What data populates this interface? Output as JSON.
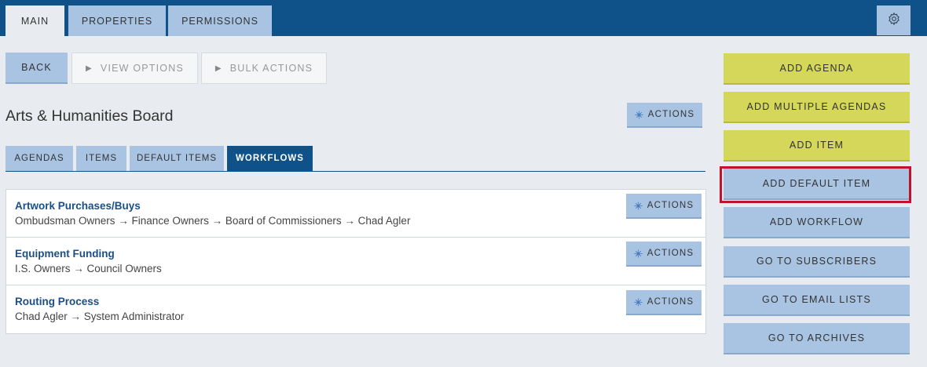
{
  "top_tabs": [
    {
      "label": "MAIN"
    },
    {
      "label": "PROPERTIES"
    },
    {
      "label": "PERMISSIONS"
    }
  ],
  "settings_icon": "gear-icon",
  "toolbar": {
    "back_label": "BACK",
    "view_options_label": "VIEW OPTIONS",
    "bulk_actions_label": "BULK ACTIONS"
  },
  "board": {
    "title": "Arts & Humanities Board",
    "actions_label": "ACTIONS"
  },
  "sub_tabs": [
    {
      "label": "AGENDAS"
    },
    {
      "label": "ITEMS"
    },
    {
      "label": "DEFAULT ITEMS"
    },
    {
      "label": "WORKFLOWS"
    }
  ],
  "workflows": [
    {
      "title": "Artwork Purchases/Buys",
      "steps": "Ombudsman Owners → Finance Owners → Board of Commissioners → Chad Agler",
      "actions_label": "ACTIONS"
    },
    {
      "title": "Equipment Funding",
      "steps": "I.S. Owners → Council Owners",
      "actions_label": "ACTIONS"
    },
    {
      "title": "Routing Process",
      "steps": "Chad Agler → System Administrator",
      "actions_label": "ACTIONS"
    }
  ],
  "sidebar": {
    "add_agenda": "ADD AGENDA",
    "add_multiple_agendas": "ADD MULTIPLE AGENDAS",
    "add_item": "ADD ITEM",
    "add_default_item": "ADD DEFAULT ITEM",
    "add_workflow": "ADD WORKFLOW",
    "go_to_subscribers": "GO TO SUBSCRIBERS",
    "go_to_email_lists": "GO TO EMAIL LISTS",
    "go_to_archives": "GO TO ARCHIVES"
  },
  "colors": {
    "brand_blue": "#0f5189",
    "light_blue": "#a9c4e2",
    "yellow": "#d5d75a",
    "highlight_red": "#c0122d"
  }
}
